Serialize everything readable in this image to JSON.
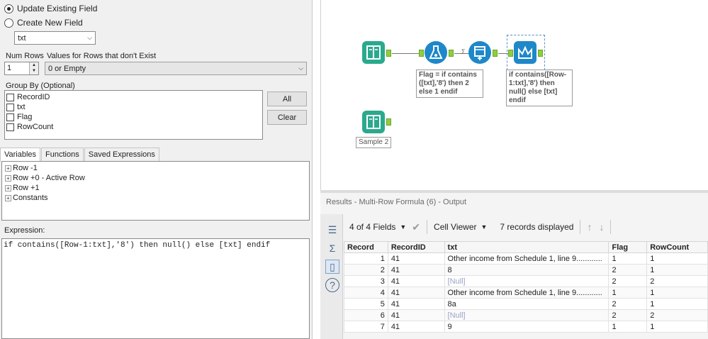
{
  "config": {
    "radio_update": "Update Existing Field",
    "radio_create": "Create New  Field",
    "field_select": "txt",
    "num_rows_label": "Num Rows",
    "num_rows_value": "1",
    "nonexist_label": "Values for Rows that don't Exist",
    "nonexist_value": "0 or Empty",
    "group_by_label": "Group By (Optional)",
    "group_by_fields": [
      "RecordID",
      "txt",
      "Flag",
      "RowCount"
    ],
    "all_button": "All",
    "clear_button": "Clear",
    "tabs": [
      "Variables",
      "Functions",
      "Saved Expressions"
    ],
    "tree_items": [
      "Row -1",
      "Row +0 - Active Row",
      "Row +1",
      "Constants"
    ],
    "expression_label": "Expression:",
    "expression": "if contains([Row-1:txt],'8') then null() else [txt] endif"
  },
  "canvas": {
    "formula_label": "Flag = if contains ([txt],'8') then 2 else 1 endif",
    "multirow_label": "if contains([Row-1:txt],'8') then null() else [txt] endif",
    "sample_label": "Sample 2",
    "colors": {
      "input": "#2aa98e",
      "formula": "#1e88c9",
      "accent": "#8fcf3e"
    }
  },
  "results": {
    "title": "Results - Multi-Row Formula (6) - Output",
    "fields_label": "4 of 4 Fields",
    "cell_viewer": "Cell Viewer",
    "records_label": "7 records displayed",
    "columns": [
      "Record",
      "RecordID",
      "txt",
      "Flag",
      "RowCount"
    ],
    "rows": [
      [
        "1",
        "41",
        "Other income from Schedule 1, line 9............",
        "1",
        "1"
      ],
      [
        "2",
        "41",
        "8",
        "2",
        "1"
      ],
      [
        "3",
        "41",
        "[Null]",
        "2",
        "2"
      ],
      [
        "4",
        "41",
        "Other income from Schedule 1, line 9............",
        "1",
        "1"
      ],
      [
        "5",
        "41",
        "8a",
        "2",
        "1"
      ],
      [
        "6",
        "41",
        "[Null]",
        "2",
        "2"
      ],
      [
        "7",
        "41",
        "9",
        "1",
        "1"
      ]
    ]
  }
}
